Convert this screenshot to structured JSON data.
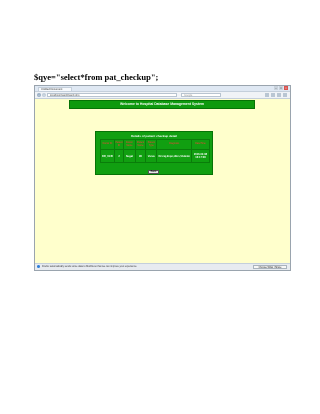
{
  "code_line": "$qye=\"select*from pat_checkup\";",
  "browser": {
    "tab_title": "Untitled Document",
    "url": "localhost/Gardi/Gardi.php",
    "search_placeholder": "Google",
    "status_text": "Firefox automatically sends some data to Mozilla so that we can improve your experience.",
    "status_button": "Choose What I Share"
  },
  "page": {
    "banner": "Welcome to Hospital Database Management System",
    "panel_title": "Details of patient checkup detail",
    "table": {
      "headers": [
        "Doctor ID",
        "Patient ID",
        "Doctor Name",
        "Patient Name",
        "Patient Type",
        "Diagnosis",
        "Date/Time"
      ],
      "rows": [
        [
          "DR_0145",
          "2",
          "Sugat",
          "90",
          "Varus",
          "Drvraj,Evpn,Hbrs,Vbdetm",
          "2016-02-08 16:17:08"
        ]
      ]
    },
    "back_button": "Back"
  }
}
